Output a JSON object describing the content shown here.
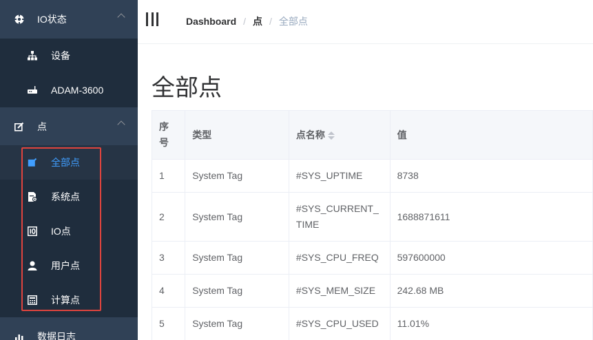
{
  "sidebar": {
    "items": [
      {
        "label": "IO状态",
        "icon": "io-status-icon"
      },
      {
        "label": "设备",
        "icon": "device-tree-icon"
      },
      {
        "label": "ADAM-3600",
        "icon": "router-icon"
      },
      {
        "label": "点",
        "icon": "edit-icon"
      },
      {
        "label": "全部点",
        "icon": "all-points-icon"
      },
      {
        "label": "系统点",
        "icon": "system-points-icon"
      },
      {
        "label": "IO点",
        "icon": "io-points-icon"
      },
      {
        "label": "用户点",
        "icon": "user-icon"
      },
      {
        "label": "计算点",
        "icon": "calculator-icon"
      },
      {
        "label": "数据日志",
        "icon": "chart-icon"
      }
    ],
    "active_color": "#409eff",
    "background": "#304156"
  },
  "breadcrumb": {
    "items": [
      "Dashboard",
      "点",
      "全部点"
    ]
  },
  "page": {
    "title": "全部点"
  },
  "table": {
    "columns": [
      "序号",
      "类型",
      "点名称",
      "值"
    ],
    "rows": [
      [
        "1",
        "System Tag",
        "#SYS_UPTIME",
        "8738"
      ],
      [
        "2",
        "System Tag",
        "#SYS_CURRENT_TIME",
        "1688871611"
      ],
      [
        "3",
        "System Tag",
        "#SYS_CPU_FREQ",
        "597600000"
      ],
      [
        "4",
        "System Tag",
        "#SYS_MEM_SIZE",
        "242.68 MB"
      ],
      [
        "5",
        "System Tag",
        "#SYS_CPU_USED",
        "11.01%"
      ]
    ]
  }
}
